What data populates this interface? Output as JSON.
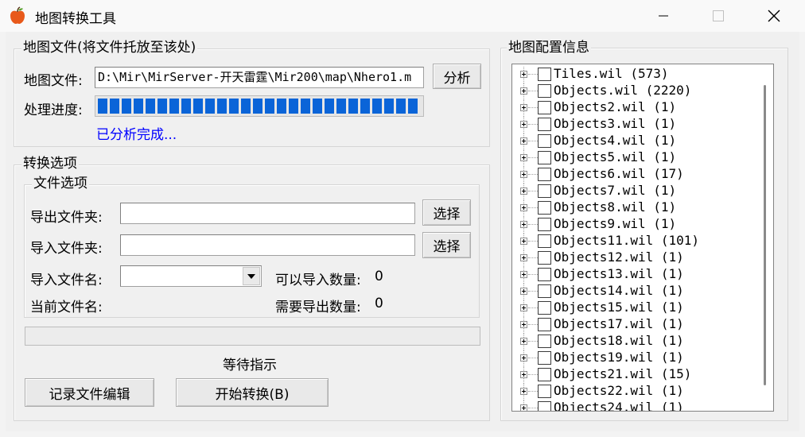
{
  "window": {
    "title": "地图转换工具"
  },
  "map_file_group": {
    "legend": "地图文件(将文件托放至该处)",
    "file_label": "地图文件:",
    "file_value": "D:\\Mir\\MirServer-开天雷霆\\Mir200\\map\\Nhero1.m",
    "analyze_button": "分析",
    "progress_label": "处理进度:",
    "progress_fraction": 1.0,
    "status": "已分析完成..."
  },
  "convert_group": {
    "legend": "转换选项",
    "file_options": {
      "legend": "文件选项",
      "export_folder_label": "导出文件夹:",
      "export_folder_value": "",
      "import_folder_label": "导入文件夹:",
      "import_folder_value": "",
      "select_button": "选择",
      "import_filename_label": "导入文件名:",
      "import_filename_value": "",
      "importable_count_label": "可以导入数量:",
      "importable_count": "0",
      "current_filename_label": "当前文件名:",
      "export_needed_label": "需要导出数量:",
      "export_needed_count": "0"
    }
  },
  "bottom": {
    "wait_status": "等待指示",
    "edit_log_button": "记录文件编辑",
    "start_button": "开始转换(B)"
  },
  "config_group": {
    "legend": "地图配置信息",
    "items": [
      "Tiles.wil (573)",
      "Objects.wil (2220)",
      "Objects2.wil (1)",
      "Objects3.wil (1)",
      "Objects4.wil (1)",
      "Objects5.wil (1)",
      "Objects6.wil (17)",
      "Objects7.wil (1)",
      "Objects8.wil (1)",
      "Objects9.wil (1)",
      "Objects11.wil (101)",
      "Objects12.wil (1)",
      "Objects13.wil (1)",
      "Objects14.wil (1)",
      "Objects15.wil (1)",
      "Objects17.wil (1)",
      "Objects18.wil (1)",
      "Objects19.wil (1)",
      "Objects21.wil (15)",
      "Objects22.wil (1)",
      "Objects24.wil (1)"
    ]
  },
  "colors": {
    "progress": "#0a64d8",
    "status_text": "#0000ff"
  }
}
